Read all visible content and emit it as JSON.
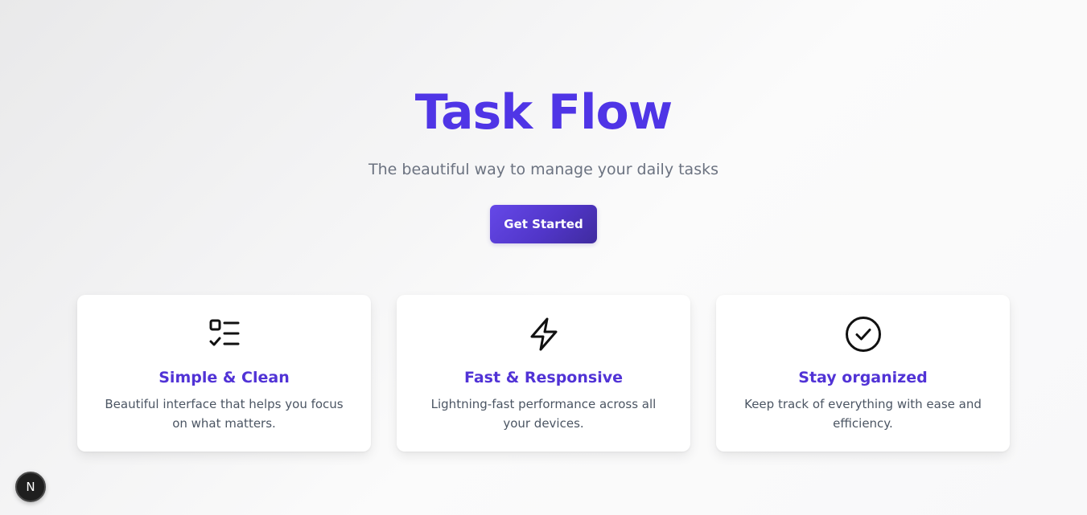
{
  "hero": {
    "title": "Task Flow",
    "subtitle": "The beautiful way to manage your daily tasks",
    "cta_label": "Get Started"
  },
  "colors": {
    "accent": "#4f35e6",
    "card_title": "#5133d6",
    "button_start": "#6548e8",
    "button_end": "#3f2b9e"
  },
  "features": [
    {
      "icon": "checklist-icon",
      "title": "Simple & Clean",
      "description": "Beautiful interface that helps you focus on what matters."
    },
    {
      "icon": "lightning-bolt-icon",
      "title": "Fast & Responsive",
      "description": "Lightning-fast performance across all your devices."
    },
    {
      "icon": "check-circle-icon",
      "title": "Stay organized",
      "description": "Keep track of everything with ease and efficiency."
    }
  ],
  "dev_badge": {
    "label": "N",
    "icon": "nextjs-icon"
  }
}
